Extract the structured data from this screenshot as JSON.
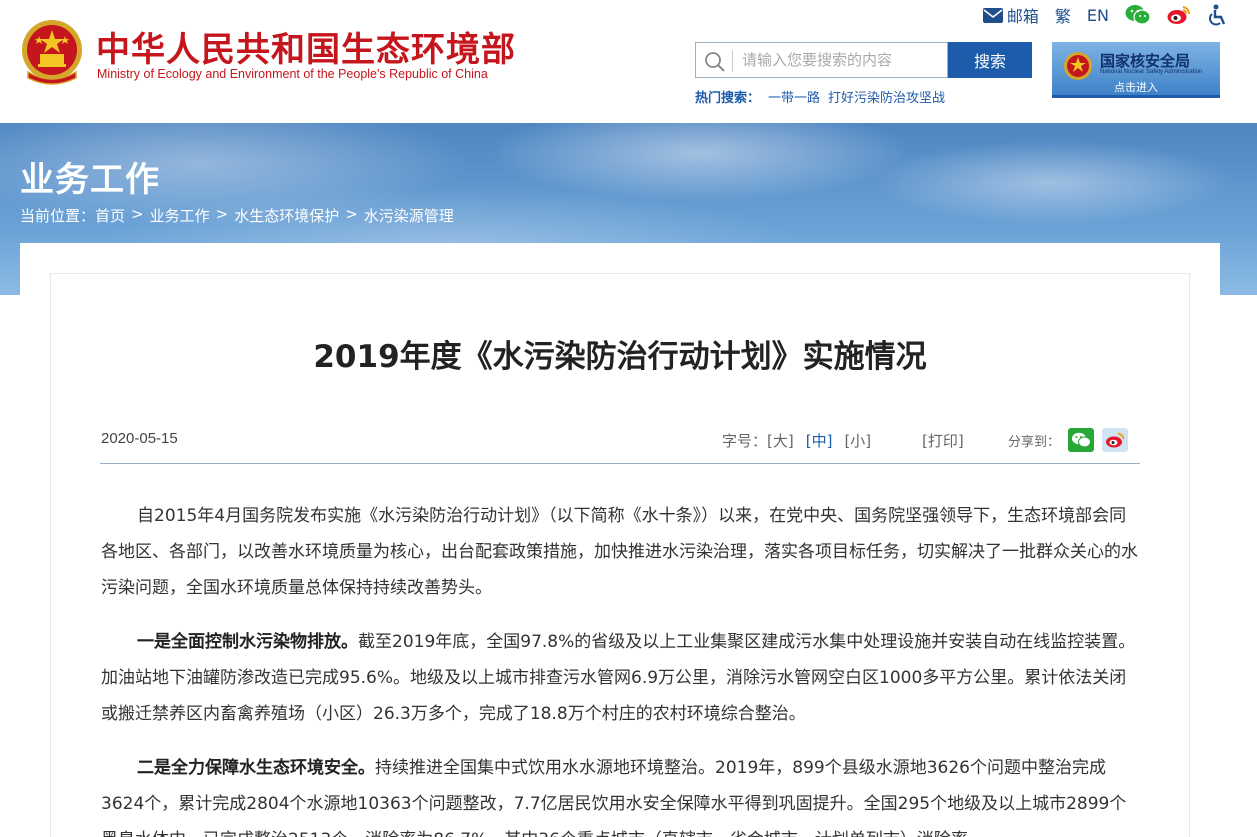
{
  "header": {
    "brand_cn": "中华人民共和国生态环境部",
    "brand_en": "Ministry of Ecology and Environment of the People's Republic of China",
    "top_links": {
      "mailbox": "邮箱",
      "traditional": "繁",
      "english": "EN"
    },
    "search": {
      "placeholder": "请输入您要搜索的内容",
      "button": "搜索"
    },
    "hot_search": {
      "label": "热门搜索：",
      "items": [
        "一带一路",
        "打好污染防治攻坚战"
      ]
    },
    "nnsa": {
      "name_cn": "国家核安全局",
      "name_en": "National Nuclear Safety Administration",
      "enter": "点击进入"
    }
  },
  "banner": {
    "section_title": "业务工作",
    "breadcrumb": {
      "prefix": "当前位置：",
      "items": [
        "首页",
        ">",
        "业务工作",
        ">",
        "水生态环境保护",
        ">",
        "水污染源管理"
      ]
    }
  },
  "article": {
    "title": "2019年度《水污染防治行动计划》实施情况",
    "date": "2020-05-15",
    "font_size": {
      "label": "字号：",
      "large": "[大]",
      "medium": "[中]",
      "small": "[小]"
    },
    "print": "[打印]",
    "share_label": "分享到：",
    "paragraphs": [
      {
        "bold": "",
        "text": "自2015年4月国务院发布实施《水污染防治行动计划》（以下简称《水十条》）以来，在党中央、国务院坚强领导下，生态环境部会同各地区、各部门，以改善水环境质量为核心，出台配套政策措施，加快推进水污染治理，落实各项目标任务，切实解决了一批群众关心的水污染问题，全国水环境质量总体保持持续改善势头。"
      },
      {
        "bold": "一是全面控制水污染物排放。",
        "text": "截至2019年底，全国97.8%的省级及以上工业集聚区建成污水集中处理设施并安装自动在线监控装置。加油站地下油罐防渗改造已完成95.6%。地级及以上城市排查污水管网6.9万公里，消除污水管网空白区1000多平方公里。累计依法关闭或搬迁禁养区内畜禽养殖场（小区）26.3万多个，完成了18.8万个村庄的农村环境综合整治。"
      },
      {
        "bold": "二是全力保障水生态环境安全。",
        "text": "持续推进全国集中式饮用水水源地环境整治。2019年，899个县级水源地3626个问题中整治完成3624个，累计完成2804个水源地10363个问题整改，7.7亿居民饮用水安全保障水平得到巩固提升。全国295个地级及以上城市2899个黑臭水体中，已完成整治2513个，消除率为86.7%，其中36个重点城市（直辖市、省会城市、计划单列市）消除率"
      }
    ]
  },
  "colors": {
    "brand_red": "#c4161c",
    "primary_blue": "#1d5cab",
    "banner_blue": "#5a91cb"
  }
}
